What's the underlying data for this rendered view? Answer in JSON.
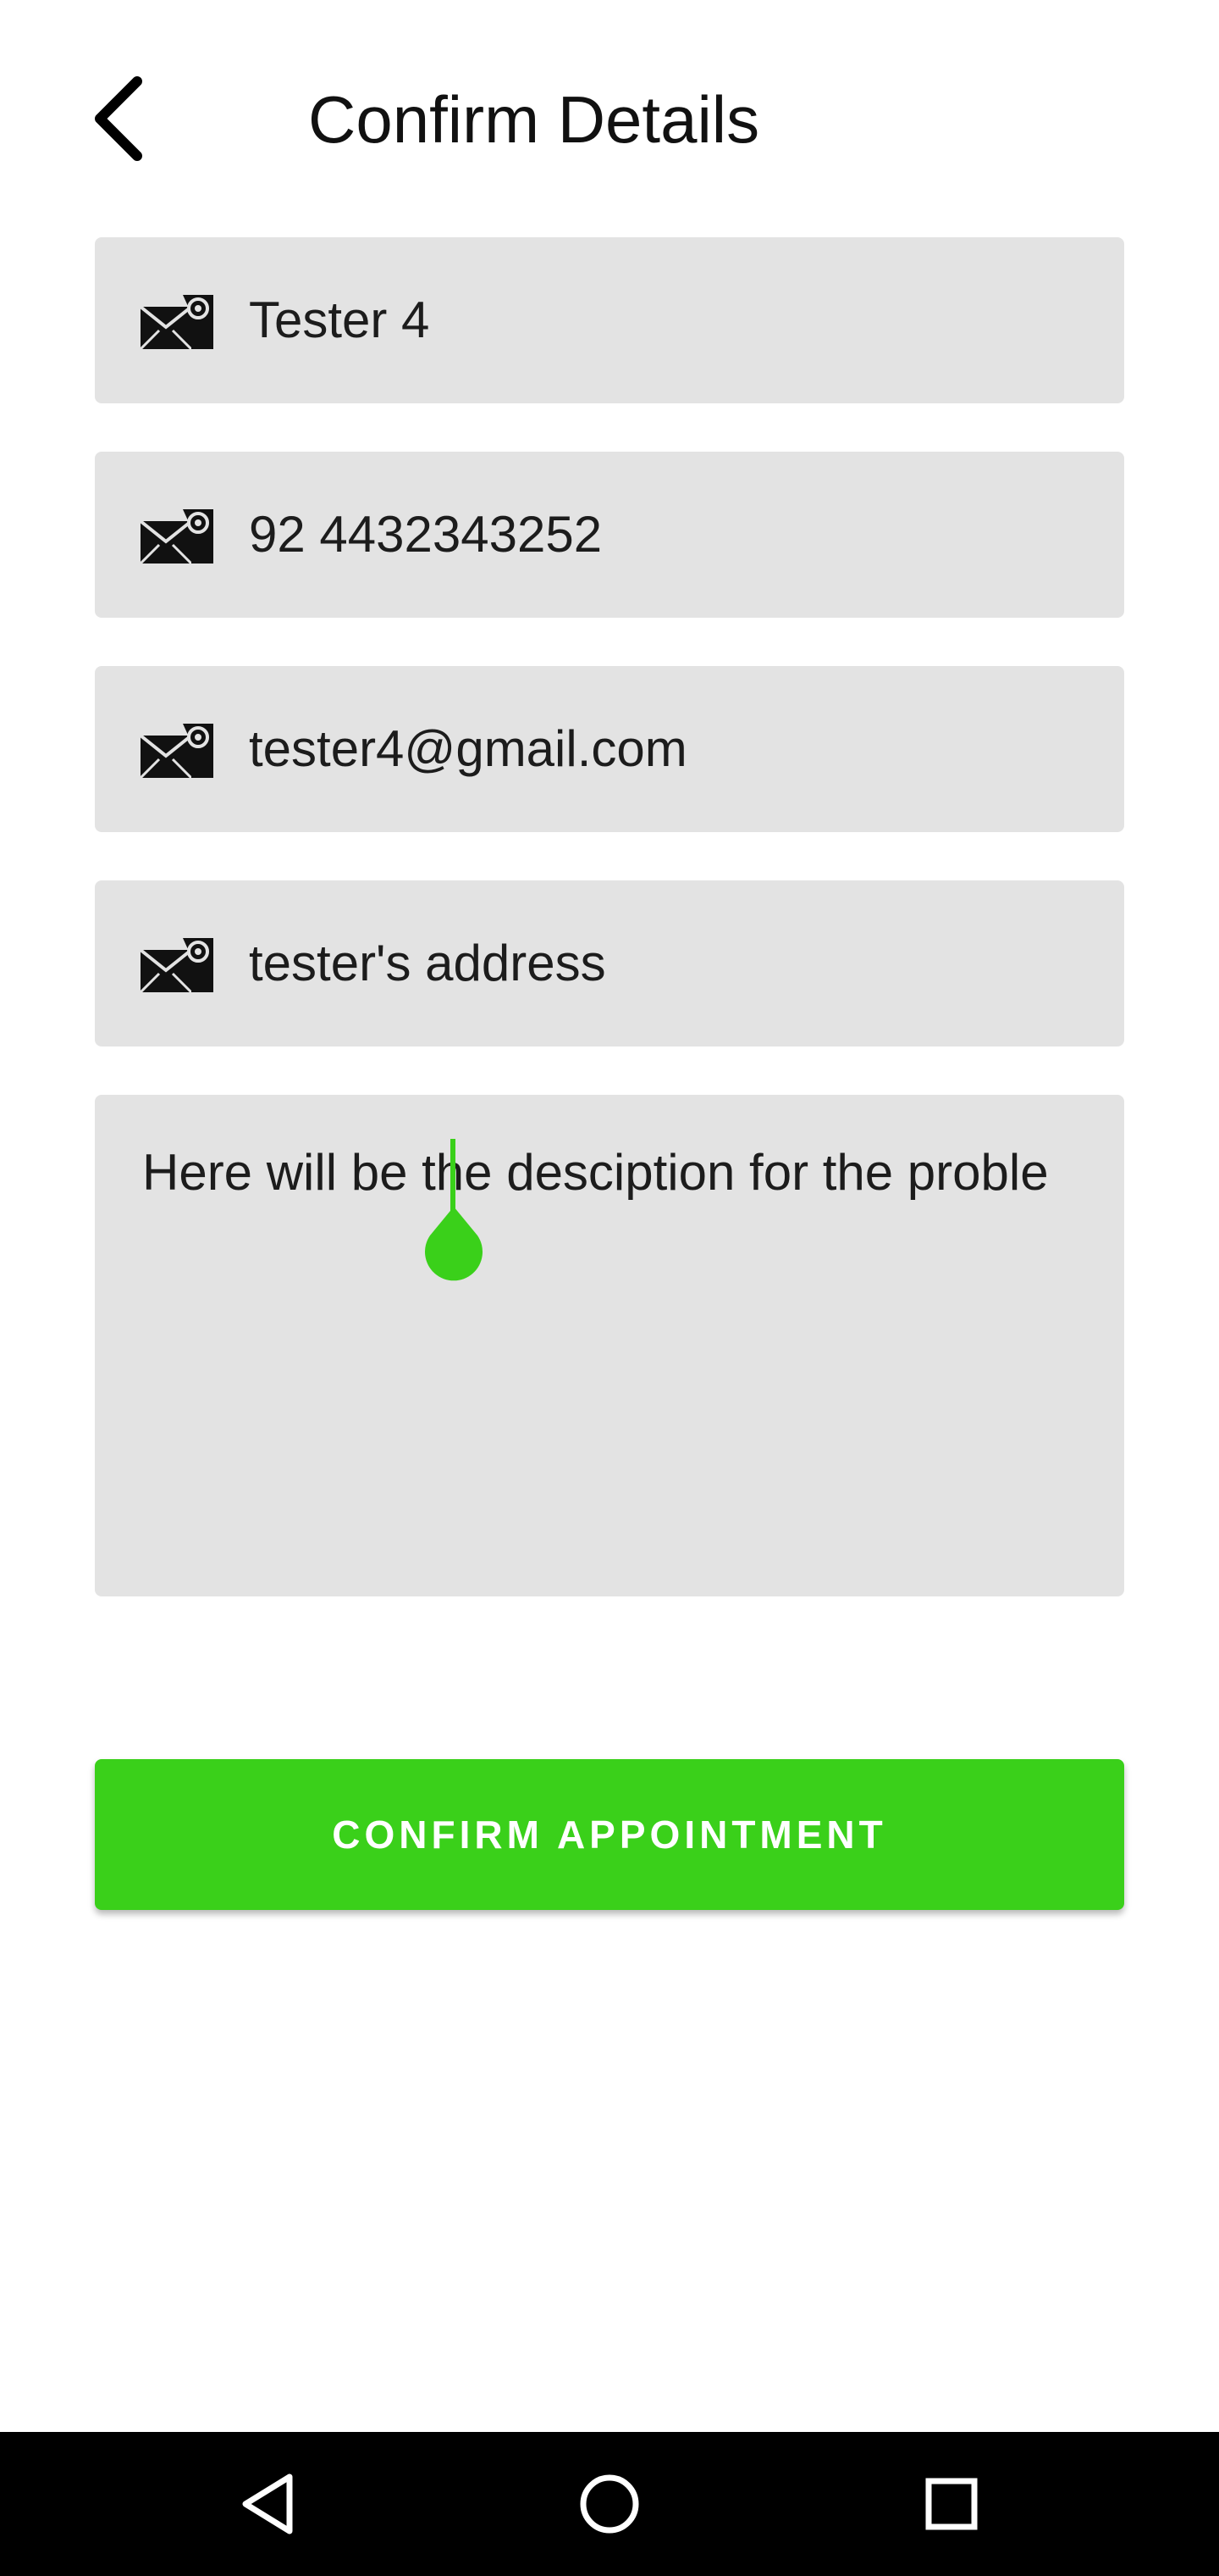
{
  "header": {
    "title": "Confirm Details",
    "back_icon": "chevron-left-icon"
  },
  "form": {
    "fields": [
      {
        "name": "name",
        "icon": "mail-at-icon",
        "value": "Tester 4"
      },
      {
        "name": "phone",
        "icon": "mail-at-icon",
        "value": "92 4432343252"
      },
      {
        "name": "email",
        "icon": "mail-at-icon",
        "value": "tester4@gmail.com"
      },
      {
        "name": "address",
        "icon": "mail-at-icon",
        "value": "tester's address"
      }
    ],
    "description": "Here will be the desciption for the proble"
  },
  "confirm_button": {
    "label": "CONFIRM APPOINTMENT"
  },
  "navbar": {
    "icons": [
      "back-triangle-icon",
      "home-circle-icon",
      "recents-square-icon"
    ]
  },
  "colors": {
    "accent": "#3ad01a",
    "field_background": "#e3e3e3",
    "text": "#1c1c1c",
    "navbar": "#000000"
  }
}
